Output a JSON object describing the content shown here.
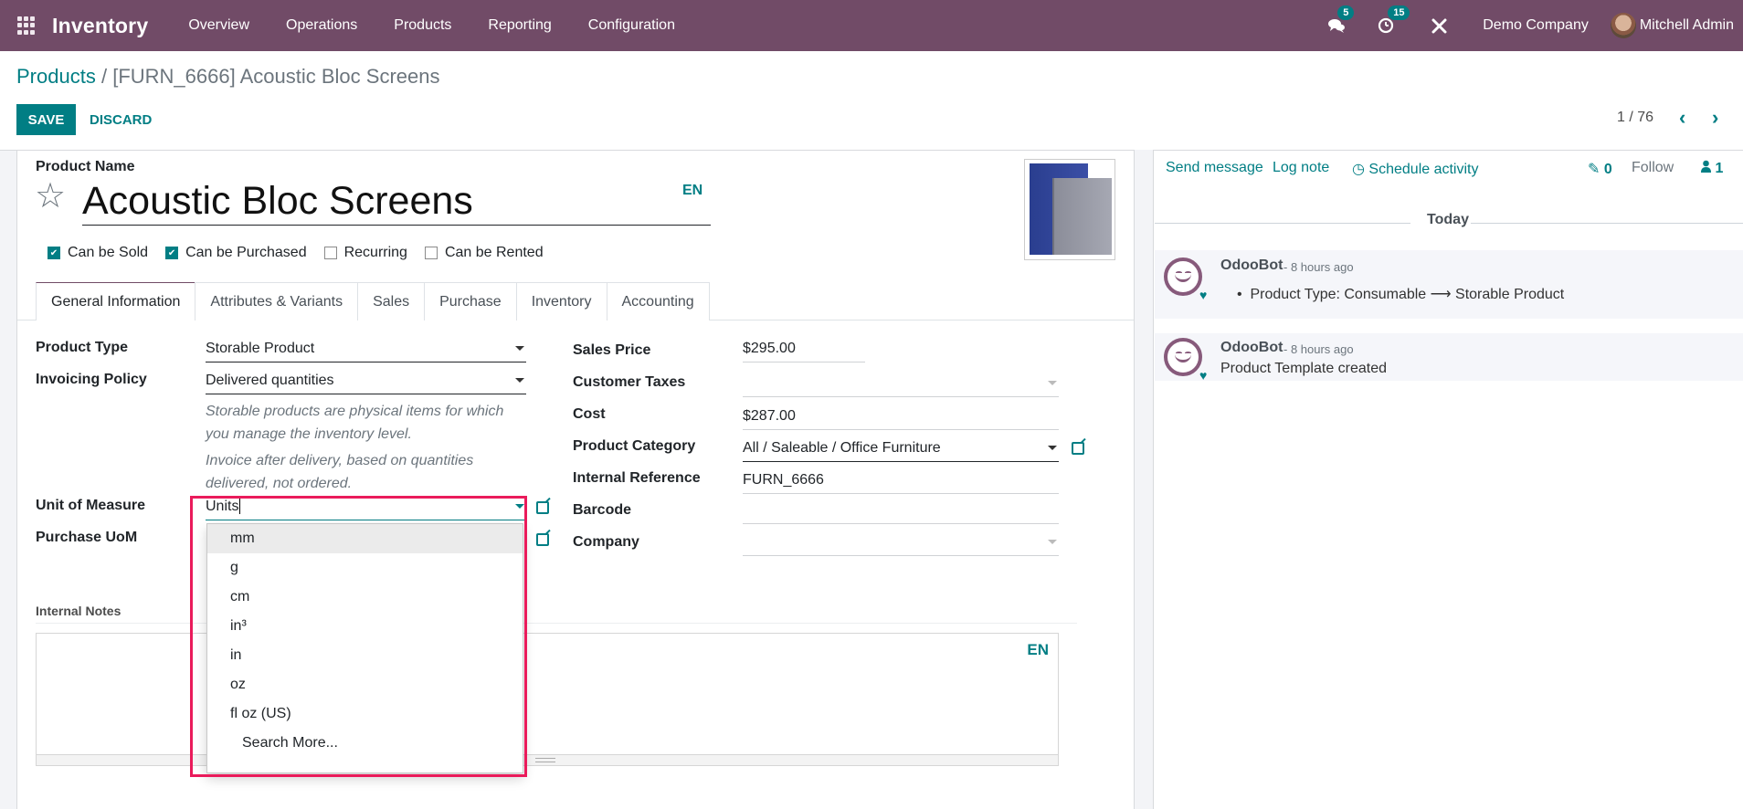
{
  "navbar": {
    "app_name": "Inventory",
    "menu": [
      "Overview",
      "Operations",
      "Products",
      "Reporting",
      "Configuration"
    ],
    "messages_count": "5",
    "activities_count": "15",
    "company": "Demo Company",
    "user": "Mitchell Admin",
    "colors": {
      "brand": "#714B67",
      "accent": "#017e84"
    }
  },
  "breadcrumb": {
    "parent": "Products",
    "separator": "/",
    "current": "[FURN_6666] Acoustic Bloc Screens"
  },
  "actions": {
    "save": "SAVE",
    "discard": "DISCARD"
  },
  "pager": {
    "value": "1 / 76",
    "prev": "‹",
    "next": "›"
  },
  "form": {
    "product_name_label": "Product Name",
    "product_name": "Acoustic Bloc Screens",
    "lang": "EN",
    "checkboxes": [
      {
        "label": "Can be Sold",
        "checked": true
      },
      {
        "label": "Can be Purchased",
        "checked": true
      },
      {
        "label": "Recurring",
        "checked": false
      },
      {
        "label": "Can be Rented",
        "checked": false
      }
    ],
    "tabs": [
      "General Information",
      "Attributes & Variants",
      "Sales",
      "Purchase",
      "Inventory",
      "Accounting"
    ],
    "active_tab": "General Information",
    "left_fields": {
      "product_type_label": "Product Type",
      "product_type": "Storable Product",
      "invoicing_policy_label": "Invoicing Policy",
      "invoicing_policy": "Delivered quantities",
      "help_storable": "Storable products are physical items for which you manage the inventory level.",
      "help_invoice": "Invoice after delivery, based on quantities delivered, not ordered.",
      "uom_label": "Unit of Measure",
      "uom_value": "Units",
      "purchase_uom_label": "Purchase UoM"
    },
    "right_fields": {
      "sales_price_label": "Sales Price",
      "sales_price": "$295.00",
      "customer_taxes_label": "Customer Taxes",
      "customer_taxes": "",
      "cost_label": "Cost",
      "cost": "$287.00",
      "category_label": "Product Category",
      "category": "All / Saleable / Office Furniture",
      "internal_ref_label": "Internal Reference",
      "internal_ref": "FURN_6666",
      "barcode_label": "Barcode",
      "barcode": "",
      "company_label": "Company",
      "company": ""
    },
    "uom_dropdown": {
      "options": [
        "mm",
        "g",
        "cm",
        "in³",
        "in",
        "oz",
        "fl oz (US)"
      ],
      "highlighted": "mm",
      "search_more": "Search More..."
    },
    "internal_notes_label": "Internal Notes",
    "notes_lang": "EN"
  },
  "chatter": {
    "send_message": "Send message",
    "log_note": "Log note",
    "schedule_activity": "Schedule activity",
    "attachments_count": "0",
    "follow": "Follow",
    "followers_count": "1",
    "date_separator": "Today",
    "messages": [
      {
        "author": "OdooBot",
        "date": "- 8 hours ago",
        "body": "Product Type: Consumable ⟶ Storable Product",
        "is_tracking": true
      },
      {
        "author": "OdooBot",
        "date": "- 8 hours ago",
        "body": "Product Template created",
        "is_tracking": false
      }
    ]
  }
}
